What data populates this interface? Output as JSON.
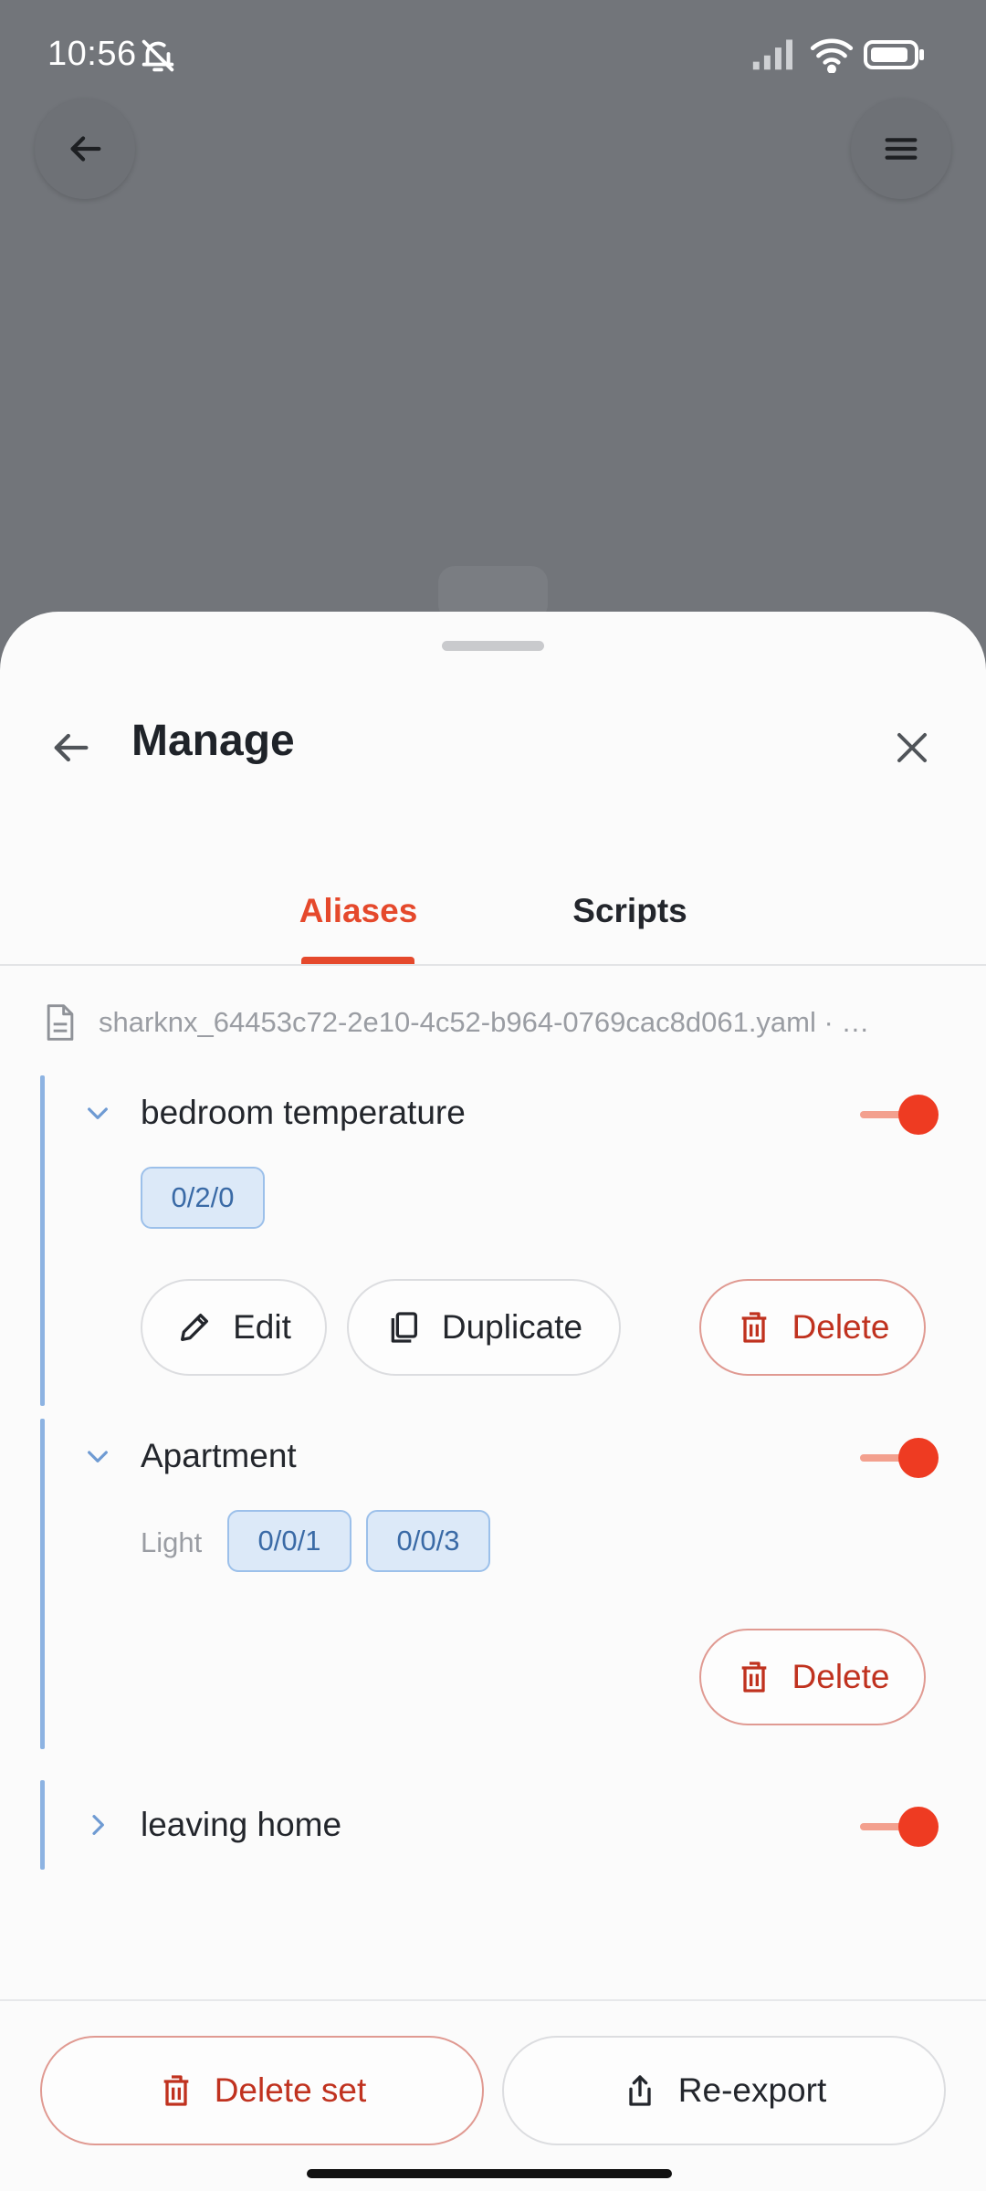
{
  "status_bar": {
    "time": "10:56",
    "icons": [
      "bell-muted-icon",
      "signal-icon",
      "wifi-icon",
      "battery-icon"
    ]
  },
  "background": {
    "back_icon": "arrow-left-icon",
    "menu_icon": "hamburger-icon"
  },
  "sheet": {
    "title": "Manage",
    "back_icon": "arrow-left-icon",
    "close_icon": "close-icon"
  },
  "tabs": [
    {
      "label": "Aliases",
      "active": true
    },
    {
      "label": "Scripts",
      "active": false
    }
  ],
  "file": {
    "icon": "file-icon",
    "name": "sharknx_64453c72-2e10-4c52-b964-0769cac8d061.yaml · …"
  },
  "groups": [
    {
      "title": "bedroom temperature",
      "expanded": true,
      "enabled": true,
      "addresses": [
        "0/2/0"
      ],
      "actions": {
        "edit": "Edit",
        "duplicate": "Duplicate",
        "delete": "Delete"
      }
    },
    {
      "title": "Apartment",
      "expanded": true,
      "enabled": true,
      "label": "Light",
      "addresses": [
        "0/0/1",
        "0/0/3"
      ],
      "actions": {
        "delete": "Delete"
      }
    },
    {
      "title": "leaving home",
      "expanded": false,
      "enabled": true
    }
  ],
  "footer": {
    "delete_set": "Delete set",
    "re_export": "Re-export"
  },
  "colors": {
    "accent": "#e5492c",
    "danger": "#c0321f",
    "chip_bg": "#dce9f8",
    "group_bar": "#8db3e2"
  }
}
